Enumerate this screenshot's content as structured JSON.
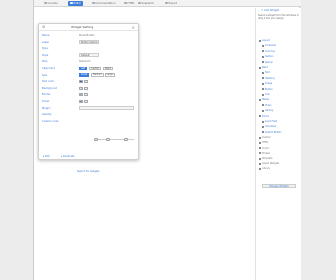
{
  "tabs": [
    {
      "label": "Console",
      "active": false
    },
    {
      "label": "Editor",
      "active": true
    },
    {
      "label": "Documentation",
      "active": false
    },
    {
      "label": "HTML",
      "active": false
    },
    {
      "label": "Snapshot",
      "active": false
    },
    {
      "label": "Export",
      "active": false
    }
  ],
  "dialog": {
    "title": "Widget Setting",
    "rows": [
      {
        "label": "Name",
        "value": "Panel Button",
        "kind": "text"
      },
      {
        "label": "Label",
        "value": "Button Section",
        "kind": "box"
      },
      {
        "label": "Type",
        "value": "",
        "kind": "text"
      },
      {
        "label": "Style",
        "value": "Default",
        "kind": "box"
      },
      {
        "label": "Role",
        "value": "Standard",
        "kind": "text"
      },
      {
        "label": "Alignment",
        "value": "",
        "kind": "seg"
      },
      {
        "label": "Size",
        "value": "",
        "kind": "seg2"
      },
      {
        "label": "Text color",
        "value": "",
        "kind": "swatch"
      },
      {
        "label": "Background",
        "value": "",
        "kind": "swatch"
      },
      {
        "label": "Border",
        "value": "",
        "kind": "swatch"
      },
      {
        "label": "Hover",
        "value": "",
        "kind": "swatch"
      },
      {
        "label": "Margin",
        "value": "",
        "kind": "box"
      },
      {
        "label": "Opacity",
        "value": "",
        "kind": "slider"
      },
      {
        "label": "Custom code",
        "value": "",
        "kind": "text"
      }
    ],
    "alignment_options": [
      "Left",
      "Center",
      "Right"
    ],
    "size_options": [
      "Small",
      "Medium",
      "Large"
    ],
    "swatch_colors": [
      "#2f5fa8",
      "#cfe0f6",
      "#8fb0d8",
      "#6a9ad0"
    ],
    "edit_buttons": [
      "Edit",
      "Duplicate"
    ],
    "search_link": "Search for widgets"
  },
  "sidebar": {
    "button": "Add Widget",
    "note": "Select a widget from the list below or drag it into your design.",
    "items": [
      {
        "label": "Layout",
        "sub": false
      },
      {
        "label": "Container",
        "sub": true
      },
      {
        "label": "Columns",
        "sub": true
      },
      {
        "label": "Section",
        "sub": true
      },
      {
        "label": "Spacer",
        "sub": true
      },
      {
        "label": "Basic",
        "sub": false
      },
      {
        "label": "Text",
        "sub": true
      },
      {
        "label": "Heading",
        "sub": true
      },
      {
        "label": "Image",
        "sub": true
      },
      {
        "label": "Button",
        "sub": true
      },
      {
        "label": "Link",
        "sub": true
      },
      {
        "label": "Media",
        "sub": false
      },
      {
        "label": "Video",
        "sub": true
      },
      {
        "label": "Gallery",
        "sub": true
      },
      {
        "label": "Forms",
        "sub": false
      },
      {
        "label": "Input Field",
        "sub": true
      },
      {
        "label": "Checkbox",
        "sub": true
      },
      {
        "label": "Submit Button",
        "sub": true
      },
      {
        "label": "Custom",
        "sub": false,
        "gray": true
      },
      {
        "label": "HTML",
        "sub": false,
        "gray": true
      },
      {
        "label": "Script",
        "sub": false,
        "gray": true
      },
      {
        "label": "Embed",
        "sub": false,
        "gray": true
      },
      {
        "label": "Template",
        "sub": false,
        "gray": true
      },
      {
        "label": "Saved Widgets",
        "sub": false,
        "gray": true
      },
      {
        "label": "Library",
        "sub": false,
        "gray": true
      }
    ],
    "footer": "Manage Widgets"
  },
  "colors": {
    "accent": "#3b7dd8"
  }
}
